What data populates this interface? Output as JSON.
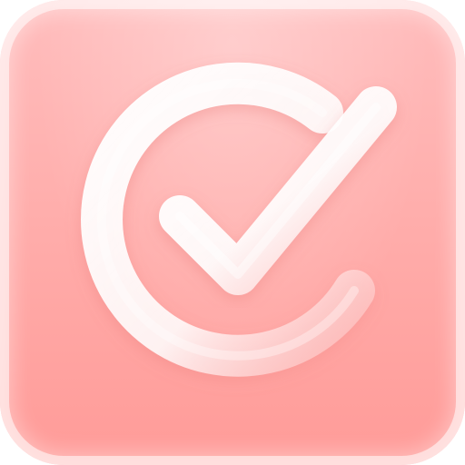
{
  "app_icon": {
    "symbol": "checkmark-in-circle-icon",
    "colors": {
      "tile_top": "#ffbdbd",
      "tile_mid": "#ffaeac",
      "tile_bottom": "#ff9b98",
      "glyph": "#ffffff"
    }
  }
}
